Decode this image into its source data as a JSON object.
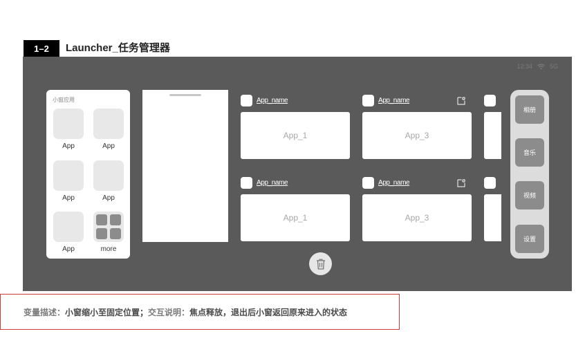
{
  "header": {
    "badge": "1–2",
    "title": "Launcher_任务管理器"
  },
  "status_bar": {
    "time": "12:34",
    "wifi_icon": "wifi-icon",
    "network": "5G"
  },
  "mini_window_panel": {
    "title": "小窗应用",
    "apps": [
      {
        "label": "App"
      },
      {
        "label": "App"
      },
      {
        "label": "App"
      },
      {
        "label": "App"
      },
      {
        "label": "App"
      },
      {
        "label": "more"
      }
    ]
  },
  "tasks": [
    {
      "name": "App_name",
      "card": "App_1",
      "pin": false
    },
    {
      "name": "App_name",
      "card": "App_3",
      "pin": true
    },
    {
      "name": "App_name",
      "card": "App_1",
      "pin": false
    },
    {
      "name": "App_name",
      "card": "App_3",
      "pin": true
    }
  ],
  "dock": {
    "items": [
      "相册",
      "音乐",
      "视频",
      "设置"
    ]
  },
  "trash_icon": "trash-icon",
  "description": {
    "var_key": "变量描述：",
    "var_value": "小窗缩小至固定位置；",
    "interact_key": "交互说明：",
    "interact_value": "焦点释放，退出后小窗返回原来进入的状态"
  },
  "colors": {
    "screen_bg": "#5a5a5a",
    "card_bg": "#ffffff",
    "dock_btn": "#8c8c8c",
    "desc_border": "#d63b3b"
  }
}
